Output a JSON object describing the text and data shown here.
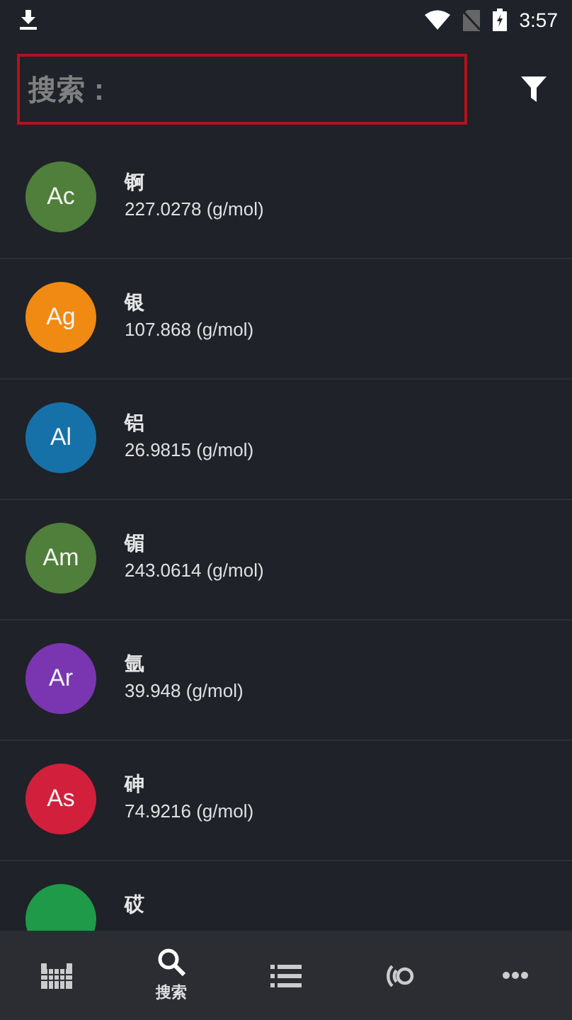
{
  "status_bar": {
    "time": "3:57"
  },
  "search": {
    "placeholder": "搜索："
  },
  "elements": [
    {
      "symbol": "Ac",
      "name": "锕",
      "mass": "227.0278 (g/mol)",
      "color": "#4f7f3a"
    },
    {
      "symbol": "Ag",
      "name": "银",
      "mass": "107.868 (g/mol)",
      "color": "#f08a12"
    },
    {
      "symbol": "Al",
      "name": "铝",
      "mass": "26.9815 (g/mol)",
      "color": "#1671a8"
    },
    {
      "symbol": "Am",
      "name": "镅",
      "mass": "243.0614 (g/mol)",
      "color": "#4f7f3a"
    },
    {
      "symbol": "Ar",
      "name": "氩",
      "mass": "39.948 (g/mol)",
      "color": "#7a36b0"
    },
    {
      "symbol": "As",
      "name": "砷",
      "mass": "74.9216 (g/mol)",
      "color": "#d21f3c"
    },
    {
      "name": "砹",
      "color": "#1e9a48"
    }
  ],
  "nav": [
    {
      "kind": "table",
      "selected": false
    },
    {
      "kind": "search",
      "label": "搜索",
      "selected": true
    },
    {
      "kind": "list",
      "selected": false
    },
    {
      "kind": "signal",
      "selected": false
    },
    {
      "kind": "more",
      "selected": false
    }
  ]
}
